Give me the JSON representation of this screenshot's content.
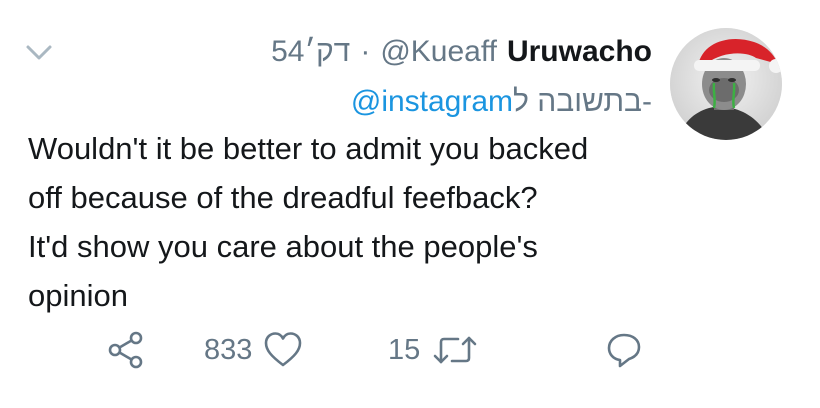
{
  "tweet": {
    "display_name": "Uruwacho",
    "handle": "@Kueaff",
    "separator": "·",
    "time": "54דק׳",
    "reply_prefix": "בתשובה ל-",
    "reply_mention": "@instagram",
    "lines": [
      "Wouldn't it be better to admit you backed",
      "off because of the dreadful feefback?",
      "It'd show you care about the people's",
      "opinion"
    ]
  },
  "actions": {
    "likes": "833",
    "retweets": "15"
  },
  "icons": [
    "chevron-down-icon",
    "share-icon",
    "heart-icon",
    "retweet-icon",
    "reply-icon"
  ],
  "colors": {
    "text": "#14171a",
    "muted": "#657786",
    "link": "#1b95e0"
  }
}
